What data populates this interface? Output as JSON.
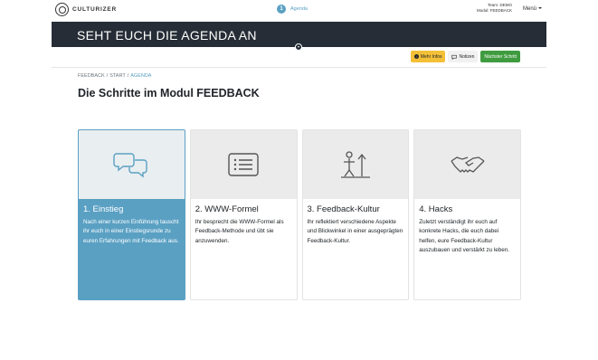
{
  "header": {
    "logo_text": "CULTURIZER",
    "step_number": "1",
    "step_label": "Agenda",
    "team_line": "Team: DEMO",
    "modul_line": "Modul: FEEDBACK",
    "menu_label": "Menü"
  },
  "banner": {
    "title": "SEHT EUCH DIE AGENDA AN"
  },
  "actions": {
    "info_label": "Mehr Infos",
    "notes_label": "Notizen",
    "next_label": "Nächster Schritt"
  },
  "breadcrumb": [
    "FEEDBACK",
    "START",
    "AGENDA"
  ],
  "page_title": "Die Schritte im Modul FEEDBACK",
  "cards": [
    {
      "icon": "chat-bubbles-icon",
      "title": "1. Einstieg",
      "text": "Nach einer kurzen Einführung tauscht ihr euch in einer Einstiegsrunde zu euren Erfahrungen mit Feedback aus."
    },
    {
      "icon": "list-icon",
      "title": "2. WWW-Formel",
      "text": "Ihr besprecht die WWW-Formel als Feedback-Methode und übt sie anzuwenden."
    },
    {
      "icon": "perspective-icon",
      "title": "3. Feedback-Kultur",
      "text": "Ihr reflektiert verschiedene Aspekte und Blickwinkel in einer ausgeprägten Feedback-Kultur."
    },
    {
      "icon": "handshake-icon",
      "title": "4. Hacks",
      "text": "Zuletzt verständigt ihr euch auf konkrete Hacks, die euch dabei helfen, eure Feedback-Kultur auszubauen und verstärkt zu leben."
    }
  ],
  "colors": {
    "banner": "#262d36",
    "accent": "#5aa0c3",
    "info_button": "#f3c038",
    "next_button": "#3f9b3f"
  }
}
